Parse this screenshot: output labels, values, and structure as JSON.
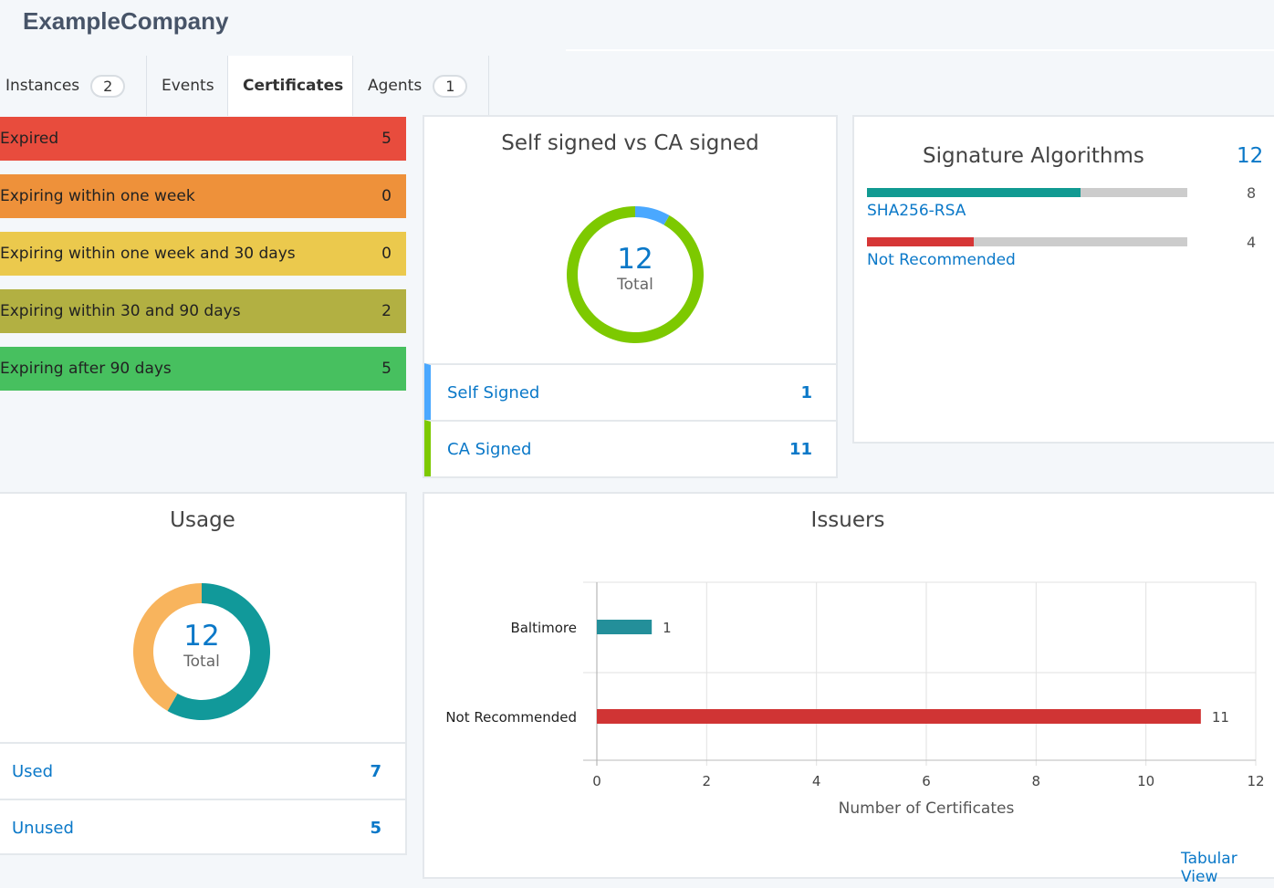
{
  "header": {
    "title": "ExampleCompany"
  },
  "tabs": [
    {
      "label": "Instances",
      "count": "2"
    },
    {
      "label": "Events"
    },
    {
      "label": "Certificates",
      "active": true
    },
    {
      "label": "Agents",
      "count": "1"
    }
  ],
  "expiry": [
    {
      "label": "Expired",
      "value": "5",
      "color": "#e84c3d"
    },
    {
      "label": "Expiring within one week",
      "value": "0",
      "color": "#ee913a"
    },
    {
      "label": "Expiring within one week and 30 days",
      "value": "0",
      "color": "#ebc94d"
    },
    {
      "label": "Expiring within 30 and 90 days",
      "value": "2",
      "color": "#b2b042"
    },
    {
      "label": "Expiring after 90 days",
      "value": "5",
      "color": "#47c05f"
    }
  ],
  "signed": {
    "title": "Self signed vs CA signed",
    "total": "12",
    "total_label": "Total",
    "items": [
      {
        "label": "Self Signed",
        "value": "1",
        "color": "#4aa8ff"
      },
      {
        "label": "CA Signed",
        "value": "11",
        "color": "#7dc900"
      }
    ]
  },
  "algorithms": {
    "title": "Signature Algorithms",
    "total": "12",
    "items": [
      {
        "label": "SHA256-RSA",
        "value": "8",
        "color": "#119a92"
      },
      {
        "label": "Not Recommended",
        "value": "4",
        "color": "#d63636"
      }
    ]
  },
  "usage": {
    "title": "Usage",
    "total": "12",
    "total_label": "Total",
    "items": [
      {
        "label": "Used",
        "value": "7",
        "color": "#11999a"
      },
      {
        "label": "Unused",
        "value": "5",
        "color": "#f8b45d"
      }
    ]
  },
  "issuers": {
    "title": "Issuers",
    "link": "Tabular View"
  },
  "chart_data": {
    "type": "bar",
    "orientation": "horizontal",
    "categories": [
      "Baltimore",
      "Not Recommended"
    ],
    "values": [
      1,
      11
    ],
    "colors": [
      "#238f9a",
      "#d03434"
    ],
    "xlabel": "Number of Certificates",
    "ylabel": "",
    "xlim": [
      0,
      12
    ],
    "xticks": [
      "0",
      "2",
      "4",
      "6",
      "8",
      "10",
      "12"
    ],
    "grid": true
  }
}
